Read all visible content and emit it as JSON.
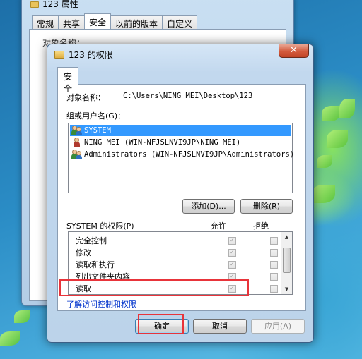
{
  "background_window": {
    "title": "123 属性",
    "tabs": [
      "常规",
      "共享",
      "安全",
      "以前的版本",
      "自定义"
    ],
    "active_tab": "安全",
    "object_label_partial": "对象名称：",
    "path_partial": "C:\\Users\\NING MEI\\Desktop\\123"
  },
  "dialog": {
    "title": "123 的权限",
    "close_symbol": "✕",
    "tab": "安全",
    "object_label": "对象名称：",
    "object_path": "C:\\Users\\NING MEI\\Desktop\\123",
    "group_label": "组或用户名(G)：",
    "users": [
      {
        "name": "SYSTEM",
        "icon": "group-icon",
        "selected": true
      },
      {
        "name": "NING MEI (WIN-NFJSLNVI9JP\\NING MEI)",
        "icon": "user-icon",
        "selected": false
      },
      {
        "name": "Administrators (WIN-NFJSLNVI9JP\\Administrators)",
        "icon": "group-icon",
        "selected": false
      }
    ],
    "add_button": "添加(D)...",
    "remove_button": "删除(R)",
    "permissions_label": "SYSTEM 的权限(P)",
    "allow_header": "允许",
    "deny_header": "拒绝",
    "permissions": [
      {
        "name": "完全控制",
        "allow": true,
        "deny": false
      },
      {
        "name": "修改",
        "allow": true,
        "deny": false
      },
      {
        "name": "读取和执行",
        "allow": true,
        "deny": false
      },
      {
        "name": "列出文件夹内容",
        "allow": true,
        "deny": false
      },
      {
        "name": "读取",
        "allow": true,
        "deny": false
      }
    ],
    "learn_link": "了解访问控制和权限",
    "ok_button": "确定",
    "cancel_button": "取消",
    "apply_button": "应用(A)",
    "check_symbol": "✓",
    "scroll_up": "▲",
    "scroll_down": "▼"
  },
  "colors": {
    "selection": "#3399ff",
    "highlight": "#e8343a",
    "link": "#0033cc"
  }
}
